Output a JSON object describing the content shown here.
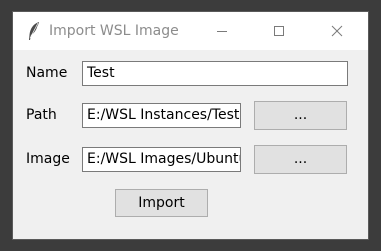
{
  "window": {
    "title": "Import WSL Image",
    "app_icon": "feather-icon",
    "controls": [
      "minimize-icon",
      "maximize-icon",
      "close-icon"
    ]
  },
  "form": {
    "name": {
      "label": "Name",
      "value": "Test"
    },
    "path": {
      "label": "Path",
      "value": "E:/WSL Instances/Test",
      "browse_label": "..."
    },
    "image": {
      "label": "Image",
      "value": "E:/WSL Images/Ubuntu",
      "browse_label": "..."
    },
    "import_label": "Import"
  }
}
